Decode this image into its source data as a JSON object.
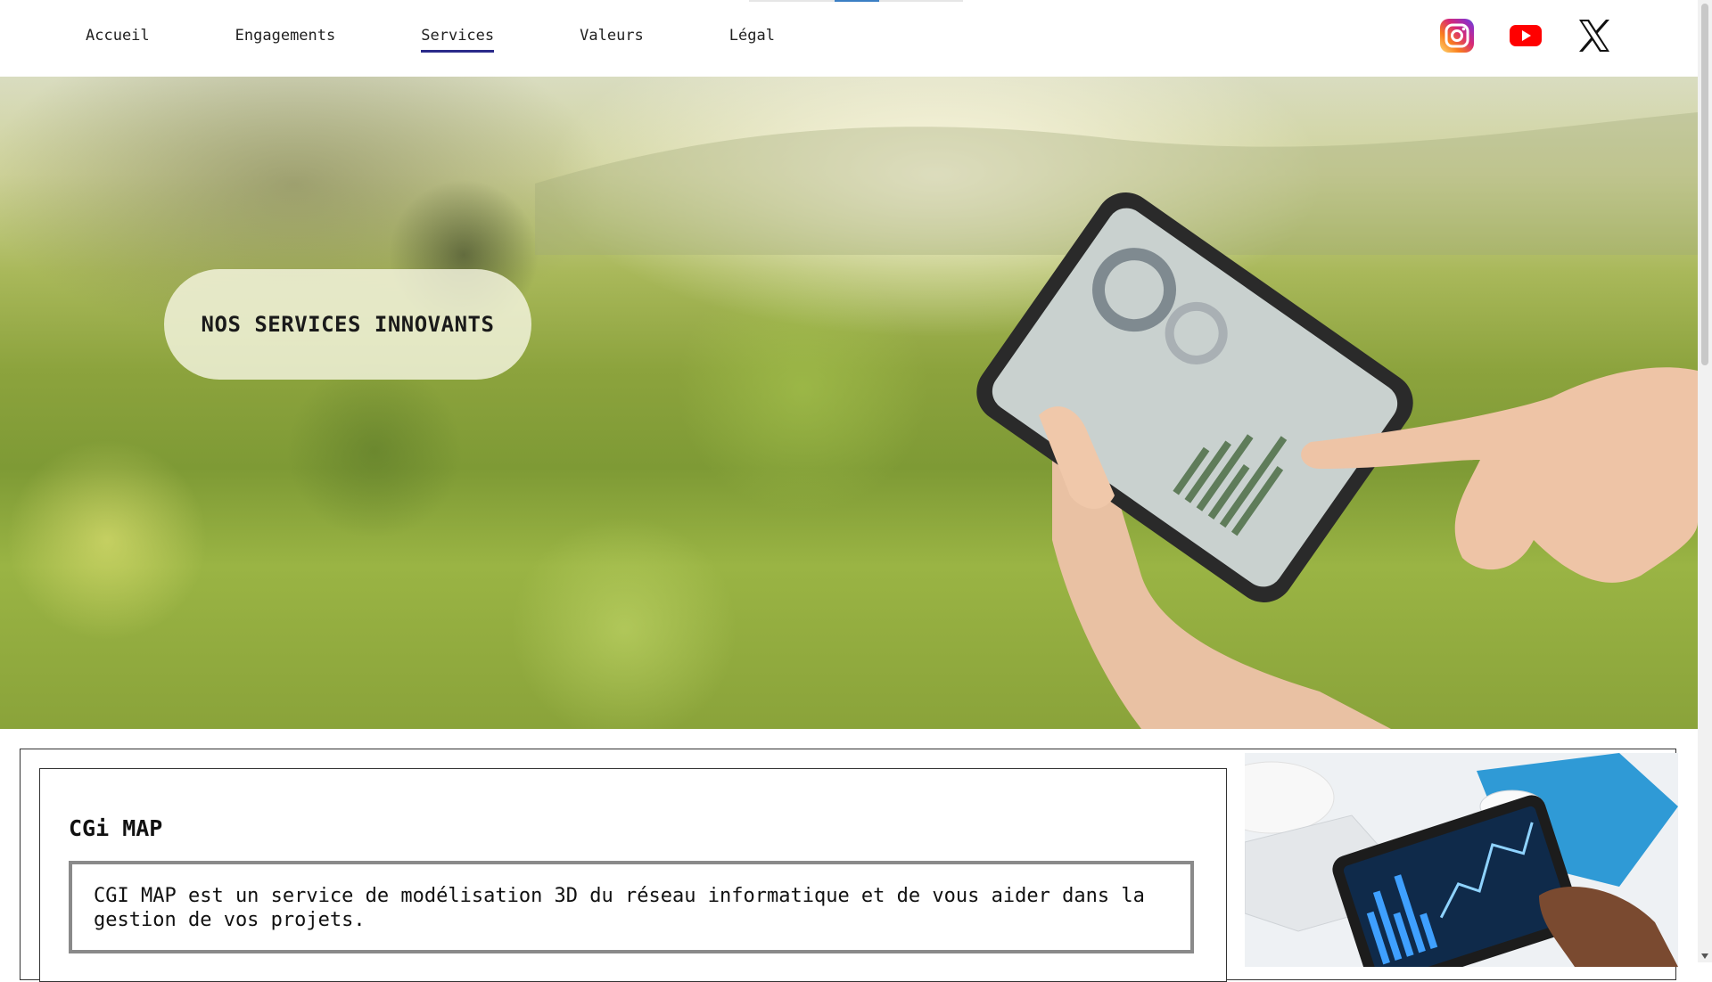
{
  "nav": {
    "links": [
      {
        "label": "Accueil",
        "active": false
      },
      {
        "label": "Engagements",
        "active": false
      },
      {
        "label": "Services",
        "active": true
      },
      {
        "label": "Valeurs",
        "active": false
      },
      {
        "label": "Légal",
        "active": false
      }
    ],
    "socials": [
      {
        "icon": "instagram-icon"
      },
      {
        "icon": "youtube-icon"
      },
      {
        "icon": "x-twitter-icon"
      }
    ]
  },
  "hero": {
    "pill_text": "NOS SERVICES INNOVANTS"
  },
  "service": {
    "title": "CGi MAP",
    "description": "CGI MAP est un service de modélisation 3D du réseau informatique et de vous aider dans la gestion de vos projets."
  },
  "colors": {
    "nav_active_underline": "#2a2a8a",
    "youtube_red": "#ff0000",
    "instagram_gradient": [
      "#feda75",
      "#fa7e1e",
      "#d62976",
      "#962fbf",
      "#4f5bd5"
    ]
  }
}
